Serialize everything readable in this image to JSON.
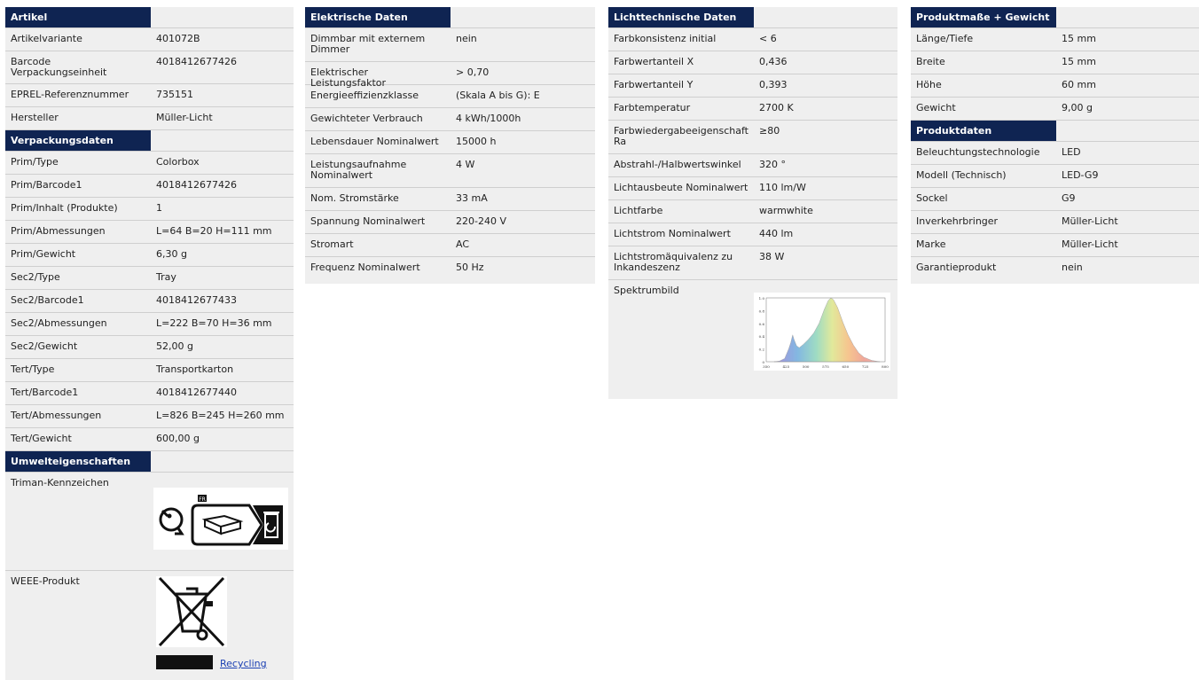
{
  "artikel": {
    "title": "Artikel",
    "rows": [
      {
        "k": "Artikelvariante",
        "v": "401072B"
      },
      {
        "k": "Barcode Verpackungseinheit",
        "v": "4018412677426"
      },
      {
        "k": "EPREL-Referenznummer",
        "v": "735151"
      },
      {
        "k": "Hersteller",
        "v": "Müller-Licht"
      }
    ]
  },
  "verpackung": {
    "title": "Verpackungsdaten",
    "rows": [
      {
        "k": "Prim/Type",
        "v": "Colorbox"
      },
      {
        "k": "Prim/Barcode1",
        "v": "4018412677426"
      },
      {
        "k": "Prim/Inhalt (Produkte)",
        "v": "1"
      },
      {
        "k": "Prim/Abmessungen",
        "v": "L=64 B=20 H=111 mm"
      },
      {
        "k": "Prim/Gewicht",
        "v": "6,30 g"
      },
      {
        "k": "Sec2/Type",
        "v": "Tray"
      },
      {
        "k": "Sec2/Barcode1",
        "v": "4018412677433"
      },
      {
        "k": "Sec2/Abmessungen",
        "v": "L=222 B=70 H=36 mm"
      },
      {
        "k": "Sec2/Gewicht",
        "v": "52,00 g"
      },
      {
        "k": "Tert/Type",
        "v": "Transportkarton"
      },
      {
        "k": "Tert/Barcode1",
        "v": "4018412677440"
      },
      {
        "k": "Tert/Abmessungen",
        "v": "L=826 B=245 H=260 mm"
      },
      {
        "k": "Tert/Gewicht",
        "v": "600,00 g"
      }
    ]
  },
  "umwelt": {
    "title": "Umwelteigenschaften",
    "triman_label": "Triman-Kennzeichen",
    "triman_fr": "FR",
    "weee_label": "WEEE-Produkt",
    "recycling_link": "Recycling"
  },
  "elektrisch": {
    "title": "Elektrische Daten",
    "rows": [
      {
        "k": "Dimmbar mit externem Dimmer",
        "v": "nein"
      },
      {
        "k": "Elektrischer Leistungsfaktor",
        "v": "> 0,70"
      },
      {
        "k": "Energieeffizienzklasse",
        "v": "(Skala A bis G): E"
      },
      {
        "k": "Gewichteter Verbrauch",
        "v": "4 kWh/1000h"
      },
      {
        "k": "Lebensdauer Nominalwert",
        "v": "15000 h"
      },
      {
        "k": "Leistungsaufnahme Nominalwert",
        "v": "4 W"
      },
      {
        "k": "Nom. Stromstärke",
        "v": "33 mA"
      },
      {
        "k": "Spannung Nominalwert",
        "v": "220-240 V"
      },
      {
        "k": "Stromart",
        "v": "AC"
      },
      {
        "k": "Frequenz Nominalwert",
        "v": "50 Hz"
      }
    ]
  },
  "licht": {
    "title": "Lichttechnische Daten",
    "rows": [
      {
        "k": "Farbkonsistenz initial",
        "v": "< 6"
      },
      {
        "k": "Farbwertanteil X",
        "v": "0,436"
      },
      {
        "k": "Farbwertanteil Y",
        "v": "0,393"
      },
      {
        "k": "Farbtemperatur",
        "v": "2700 K"
      },
      {
        "k": "Farbwiedergabeeigenschaft Ra",
        "v": "≥80"
      },
      {
        "k": "Abstrahl-/Halbwertswinkel",
        "v": "320 °"
      },
      {
        "k": "Lichtausbeute Nominalwert",
        "v": "110 lm/W"
      },
      {
        "k": "Lichtfarbe",
        "v": "warmwhite"
      },
      {
        "k": "Lichtstrom Nominalwert",
        "v": "440 lm"
      },
      {
        "k": "Lichtstromäquivalenz zu Inkandeszenz",
        "v": "38 W"
      }
    ],
    "spektrum_label": "Spektrumbild",
    "spektrum": {
      "y_ticks": [
        "1.0",
        "0.8",
        "0.6",
        "0.4",
        "0.2",
        "0"
      ],
      "x_ticks": [
        "350",
        "425",
        "500",
        "575",
        "650",
        "725",
        "800"
      ],
      "curve": [
        [
          380,
          0.0
        ],
        [
          400,
          0.01
        ],
        [
          420,
          0.05
        ],
        [
          435,
          0.2
        ],
        [
          443,
          0.3
        ],
        [
          450,
          0.42
        ],
        [
          455,
          0.35
        ],
        [
          465,
          0.25
        ],
        [
          475,
          0.22
        ],
        [
          490,
          0.27
        ],
        [
          510,
          0.35
        ],
        [
          530,
          0.45
        ],
        [
          550,
          0.6
        ],
        [
          570,
          0.82
        ],
        [
          585,
          0.96
        ],
        [
          595,
          1.0
        ],
        [
          605,
          0.97
        ],
        [
          620,
          0.85
        ],
        [
          640,
          0.62
        ],
        [
          660,
          0.42
        ],
        [
          680,
          0.26
        ],
        [
          700,
          0.14
        ],
        [
          720,
          0.07
        ],
        [
          750,
          0.02
        ],
        [
          780,
          0.0
        ]
      ]
    }
  },
  "masse": {
    "title": "Produktmaße + Gewicht",
    "rows": [
      {
        "k": "Länge/Tiefe",
        "v": "15 mm"
      },
      {
        "k": "Breite",
        "v": "15 mm"
      },
      {
        "k": "Höhe",
        "v": "60 mm"
      },
      {
        "k": "Gewicht",
        "v": "9,00 g"
      }
    ]
  },
  "produkt": {
    "title": "Produktdaten",
    "rows": [
      {
        "k": "Beleuchtungstechnologie",
        "v": "LED"
      },
      {
        "k": "Modell (Technisch)",
        "v": "LED-G9"
      },
      {
        "k": "Sockel",
        "v": "G9"
      },
      {
        "k": "Inverkehrbringer",
        "v": "Müller-Licht"
      },
      {
        "k": "Marke",
        "v": "Müller-Licht"
      },
      {
        "k": "Garantieprodukt",
        "v": "nein"
      }
    ]
  }
}
